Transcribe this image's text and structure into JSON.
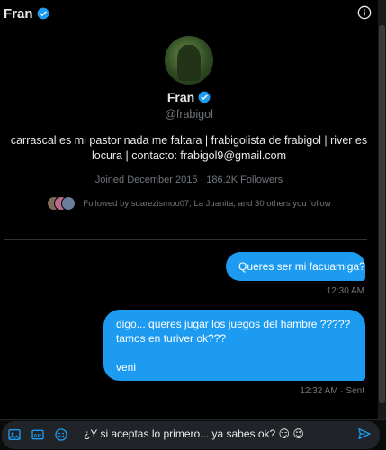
{
  "header": {
    "name": "Fran"
  },
  "profile": {
    "name": "Fran",
    "handle": "@frabigol",
    "bio_line1": "carrascal es mi pastor nada me faltara | frabigolista de frabigol | river es",
    "bio_line2": "locura | contacto: frabigol9@gmail.com",
    "joined": "Joined December 2015 · 186.2K Followers",
    "followed_by": "Followed by suarezismoo07, La Juanita, and 30 others you follow"
  },
  "messages": [
    {
      "lines": [
        "Queres ser mi facuamiga?"
      ],
      "timestamp": "12:30 AM"
    },
    {
      "lines": [
        "digo... queres jugar los juegos del hambre ?????",
        "tamos en turiver ok???",
        "",
        "veni"
      ],
      "timestamp": "12:32 AM · Sent"
    }
  ],
  "composer": {
    "text": "¿Y si aceptas lo primero... ya sabes ok? 😏 😉"
  },
  "colors": {
    "accent": "#1d9bf0",
    "background": "#000000",
    "muted": "#71767b"
  },
  "icons": [
    "verified-badge-icon",
    "info-icon",
    "image-icon",
    "gif-icon",
    "emoji-icon",
    "send-icon"
  ]
}
